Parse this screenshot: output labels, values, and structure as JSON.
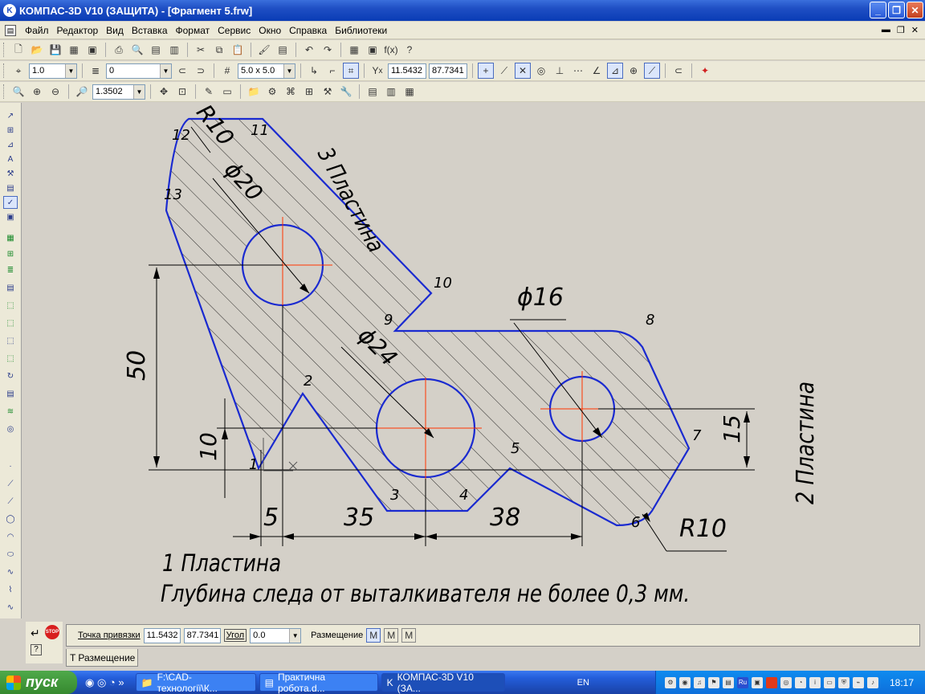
{
  "window": {
    "title": "КОМПАС-3D V10 (ЗАЩИТА) - [Фрагмент 5.frw]",
    "minimize": "_",
    "maximize": "❐",
    "close": "✕"
  },
  "menu": [
    "Файл",
    "Редактор",
    "Вид",
    "Вставка",
    "Формат",
    "Сервис",
    "Окно",
    "Справка",
    "Библиотеки"
  ],
  "toolbar": {
    "step_value": "1.0",
    "layer_value": "0",
    "grid_value": "5.0 x 5.0",
    "coord_x": "11.5432",
    "coord_y": "87.7341",
    "zoom_value": "1.3502"
  },
  "drawing": {
    "labels": {
      "plate3": "3 Пластина",
      "plate2": "2 Пластина",
      "plate1": "1 Пластина",
      "note": "Глубина следа от выталкивателя не более 0,3 мм."
    },
    "dims": {
      "r10_top": "R10",
      "d20": "ϕ20",
      "d24": "ϕ24",
      "d16": "ϕ16",
      "r10_bottom": "R10",
      "d50": "50",
      "d10": "10",
      "d15": "15",
      "d5": "5",
      "d35": "35",
      "d38": "38"
    },
    "points": [
      "1",
      "2",
      "3",
      "4",
      "5",
      "6",
      "7",
      "8",
      "9",
      "10",
      "11",
      "12",
      "13"
    ],
    "colors": {
      "contour": "#1a2ad0",
      "axis": "#ff3300",
      "hatch": "#000000"
    }
  },
  "propbar": {
    "snap_label": "Точка привязки",
    "snap_x": "11.5432",
    "snap_y": "87.7341",
    "angle_label": "Угол",
    "angle_value": "0.0",
    "placement_label": "Размещение",
    "tab_label": "Размещение"
  },
  "taskbar": {
    "start": "пуск",
    "tasks": [
      "F:\\CAD-технології\\К...",
      "Практична робота.d...",
      "КОМПАС-3D V10 (ЗА..."
    ],
    "lang": "EN",
    "time": "18:17"
  }
}
